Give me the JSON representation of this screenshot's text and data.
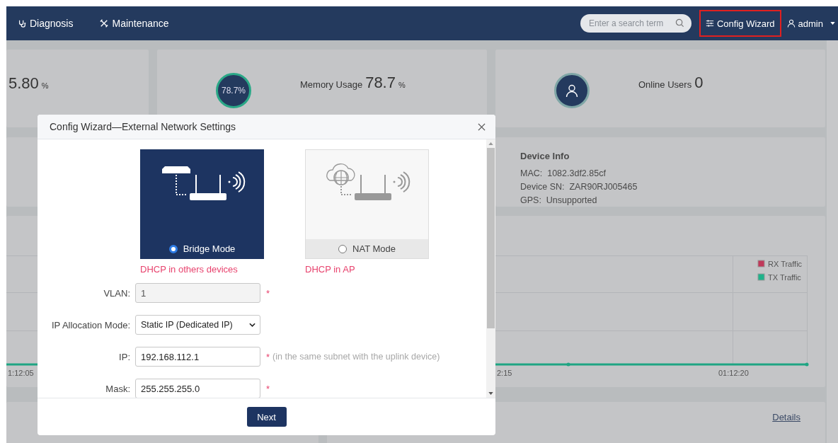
{
  "navbar": {
    "items": [
      {
        "label": "Diagnosis"
      },
      {
        "label": "Maintenance"
      }
    ],
    "search": {
      "placeholder": "Enter a search term"
    },
    "config_wizard": {
      "label": "Config Wizard",
      "highlighted": true
    },
    "user": {
      "label": "admin"
    }
  },
  "stats": [
    {
      "kind": "plain",
      "value": "5.80",
      "unit": "%"
    },
    {
      "kind": "ring",
      "ring_label": "78.7%",
      "label": "Memory Usage",
      "value": "78.7",
      "unit": "%"
    },
    {
      "kind": "avatar",
      "label": "Online Users",
      "value": "0"
    }
  ],
  "device_info": {
    "title": "Device Info",
    "fields": [
      {
        "label": "MAC:",
        "value": "1082.3df2.85cf"
      },
      {
        "label": "Device SN:",
        "value": "ZAR90RJ005465"
      },
      {
        "label": "GPS:",
        "value": "Unsupported"
      }
    ]
  },
  "traffic_chart": {
    "legend": [
      {
        "label": "RX Traffic",
        "color": "#c0395a"
      },
      {
        "label": "TX Traffic",
        "color": "#1fb28a"
      }
    ],
    "x_labels": [
      "1:12:05",
      "2:15",
      "01:12:20"
    ]
  },
  "details_link": "Details",
  "dialog": {
    "title": "Config Wizard—External Network Settings",
    "modes": [
      {
        "label": "Bridge Mode",
        "note": "DHCP in others devices",
        "selected": true
      },
      {
        "label": "NAT Mode",
        "note": "DHCP in AP",
        "selected": false
      }
    ],
    "fields": [
      {
        "kind": "input",
        "label": "VLAN:",
        "value": "1",
        "disabled": true,
        "required_mark": "*"
      },
      {
        "kind": "select",
        "label": "IP Allocation Mode:",
        "value": "Static IP (Dedicated IP)",
        "disabled": false
      },
      {
        "kind": "input",
        "label": "IP:",
        "value": "192.168.112.1",
        "disabled": false,
        "required_mark": "*",
        "hint": "(in the same subnet with the uplink device)"
      },
      {
        "kind": "input",
        "label": "Mask:",
        "value": "255.255.255.0",
        "disabled": false,
        "required_mark": "*"
      }
    ],
    "next_button": "Next"
  }
}
